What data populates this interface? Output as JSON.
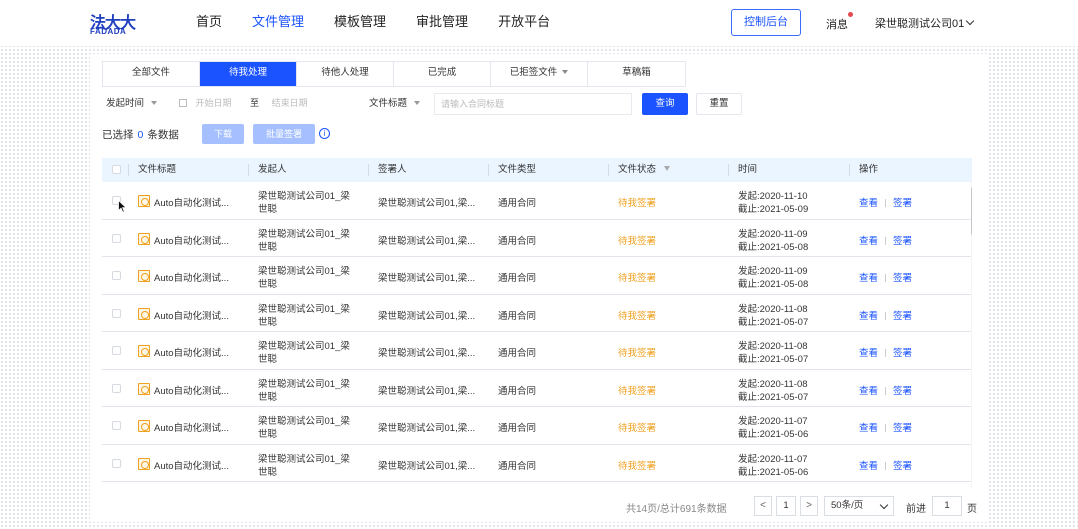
{
  "header": {
    "logo_cn": "法大大",
    "logo_en": "FADADA",
    "nav": [
      {
        "label": "首页",
        "active": false
      },
      {
        "label": "文件管理",
        "active": true
      },
      {
        "label": "模板管理",
        "active": false
      },
      {
        "label": "审批管理",
        "active": false
      },
      {
        "label": "开放平台",
        "active": false
      }
    ],
    "console_label": "控制后台",
    "message_label": "消息",
    "user_name": "梁世聪测试公司01"
  },
  "tabs": [
    {
      "label": "全部文件",
      "active": false
    },
    {
      "label": "待我处理",
      "active": true
    },
    {
      "label": "待他人处理",
      "active": false
    },
    {
      "label": "已完成",
      "active": false
    },
    {
      "label": "已拒签文件",
      "active": false,
      "dropdown": true
    },
    {
      "label": "草稿箱",
      "active": false
    }
  ],
  "filters": {
    "time_type": "发起时间",
    "start_placeholder": "开始日期",
    "range_sep": "至",
    "end_placeholder": "结束日期",
    "field_type": "文件标题",
    "keyword_placeholder": "请输入合同标题",
    "query_label": "查询",
    "reset_label": "重置"
  },
  "selection": {
    "prefix": "已选择",
    "count": "0",
    "suffix": "条数据",
    "download_label": "下载",
    "batch_sign_label": "批量签署"
  },
  "table": {
    "columns": [
      "文件标题",
      "发起人",
      "签署人",
      "文件类型",
      "文件状态",
      "时间",
      "操作"
    ],
    "rows": [
      {
        "title": "Auto自动化测试...",
        "sender_line1": "梁世聪测试公司01_梁",
        "sender_line2": "世聪",
        "signers": "梁世聪测试公司01,梁...",
        "type": "通用合同",
        "status": "待我签署",
        "start": "发起:2020-11-10",
        "end": "截止:2021-05-09",
        "op_view": "查看",
        "op_sign": "签署"
      },
      {
        "title": "Auto自动化测试...",
        "sender_line1": "梁世聪测试公司01_梁",
        "sender_line2": "世聪",
        "signers": "梁世聪测试公司01,梁...",
        "type": "通用合同",
        "status": "待我签署",
        "start": "发起:2020-11-09",
        "end": "截止:2021-05-08",
        "op_view": "查看",
        "op_sign": "签署"
      },
      {
        "title": "Auto自动化测试...",
        "sender_line1": "梁世聪测试公司01_梁",
        "sender_line2": "世聪",
        "signers": "梁世聪测试公司01,梁...",
        "type": "通用合同",
        "status": "待我签署",
        "start": "发起:2020-11-09",
        "end": "截止:2021-05-08",
        "op_view": "查看",
        "op_sign": "签署"
      },
      {
        "title": "Auto自动化测试...",
        "sender_line1": "梁世聪测试公司01_梁",
        "sender_line2": "世聪",
        "signers": "梁世聪测试公司01,梁...",
        "type": "通用合同",
        "status": "待我签署",
        "start": "发起:2020-11-08",
        "end": "截止:2021-05-07",
        "op_view": "查看",
        "op_sign": "签署"
      },
      {
        "title": "Auto自动化测试...",
        "sender_line1": "梁世聪测试公司01_梁",
        "sender_line2": "世聪",
        "signers": "梁世聪测试公司01,梁...",
        "type": "通用合同",
        "status": "待我签署",
        "start": "发起:2020-11-08",
        "end": "截止:2021-05-07",
        "op_view": "查看",
        "op_sign": "签署"
      },
      {
        "title": "Auto自动化测试...",
        "sender_line1": "梁世聪测试公司01_梁",
        "sender_line2": "世聪",
        "signers": "梁世聪测试公司01,梁...",
        "type": "通用合同",
        "status": "待我签署",
        "start": "发起:2020-11-08",
        "end": "截止:2021-05-07",
        "op_view": "查看",
        "op_sign": "签署"
      },
      {
        "title": "Auto自动化测试...",
        "sender_line1": "梁世聪测试公司01_梁",
        "sender_line2": "世聪",
        "signers": "梁世聪测试公司01,梁...",
        "type": "通用合同",
        "status": "待我签署",
        "start": "发起:2020-11-07",
        "end": "截止:2021-05-06",
        "op_view": "查看",
        "op_sign": "签署"
      },
      {
        "title": "Auto自动化测试...",
        "sender_line1": "梁世聪测试公司01_梁",
        "sender_line2": "世聪",
        "signers": "梁世聪测试公司01,梁...",
        "type": "通用合同",
        "status": "待我签署",
        "start": "发起:2020-11-07",
        "end": "截止:2021-05-06",
        "op_view": "查看",
        "op_sign": "签署"
      }
    ]
  },
  "pagination": {
    "total_text": "共14页/总计691条数据",
    "current_page": "1",
    "page_size": "50条/页",
    "goto_prefix": "前进",
    "goto_value": "1",
    "goto_suffix": "页"
  },
  "colors": {
    "primary": "#1a53ff",
    "pending": "#f0a020",
    "header_row": "#ebf5ff"
  }
}
